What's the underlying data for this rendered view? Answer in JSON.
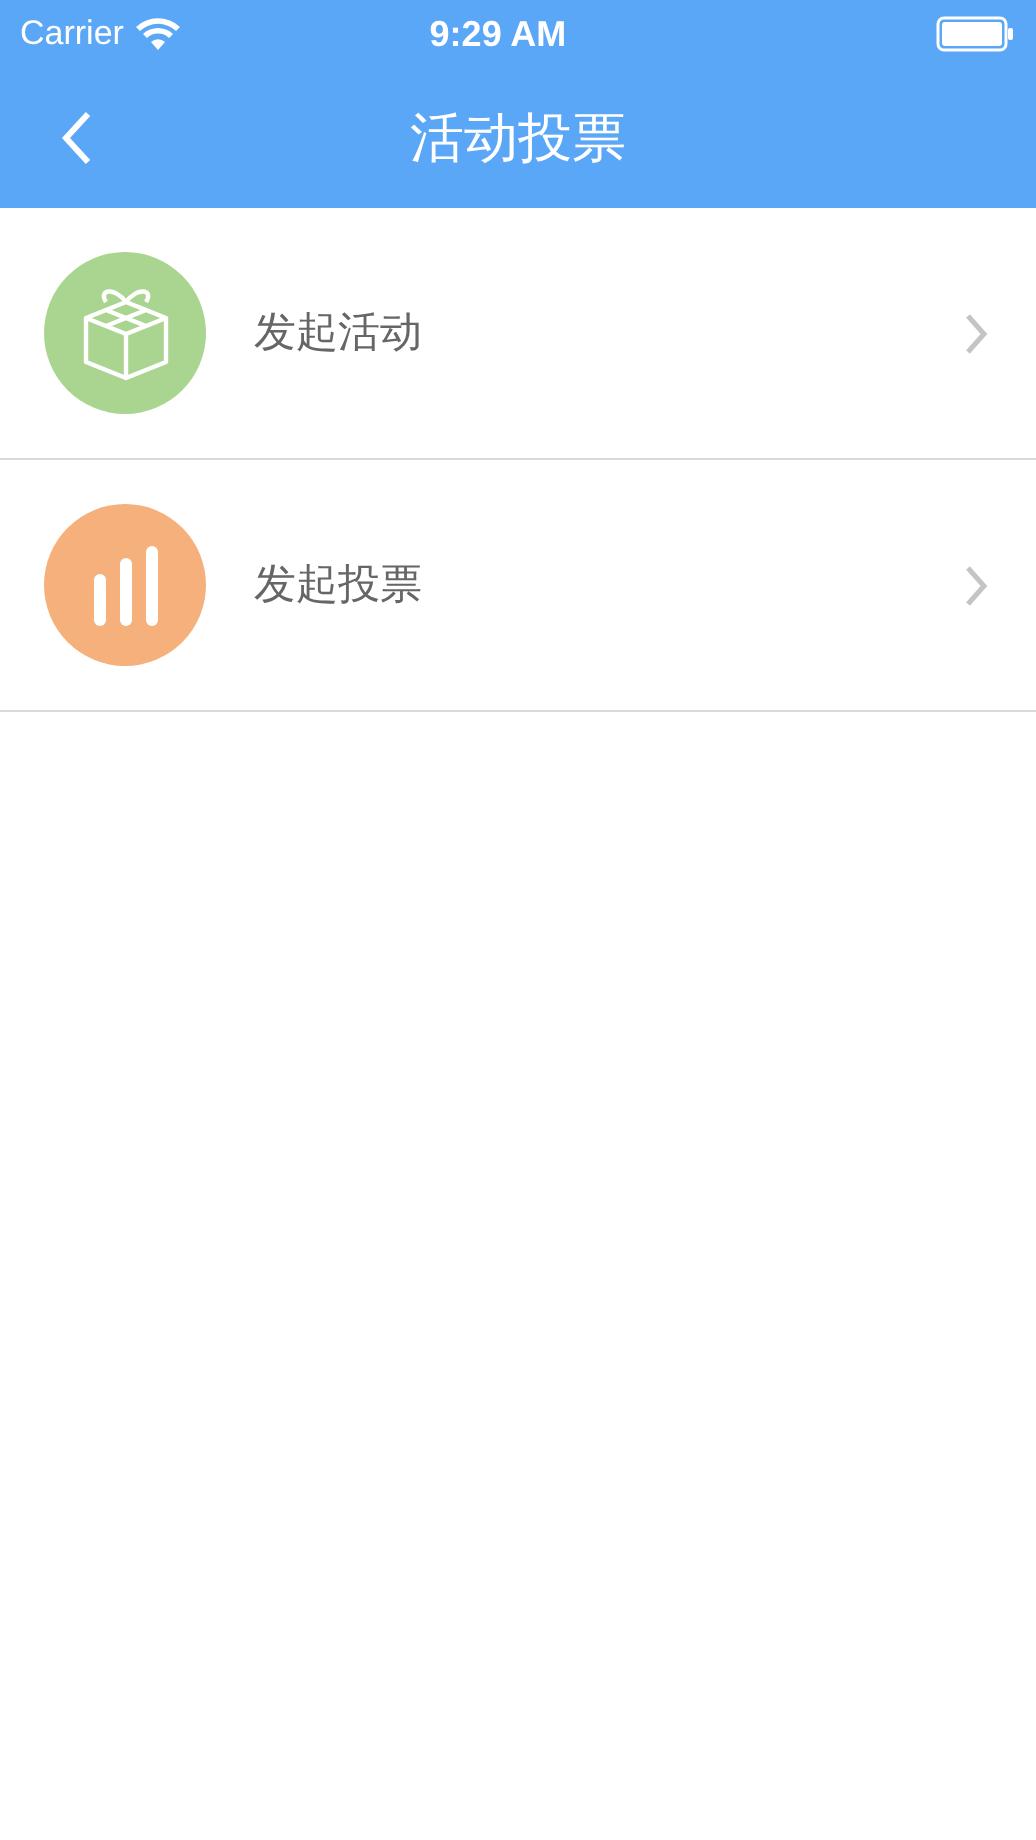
{
  "status_bar": {
    "carrier": "Carrier",
    "time": "9:29 AM"
  },
  "nav": {
    "title": "活动投票"
  },
  "items": [
    {
      "label": "发起活动",
      "kind": "gift",
      "color": "#a9d590"
    },
    {
      "label": "发起投票",
      "kind": "bars",
      "color": "#f6b07b"
    }
  ]
}
